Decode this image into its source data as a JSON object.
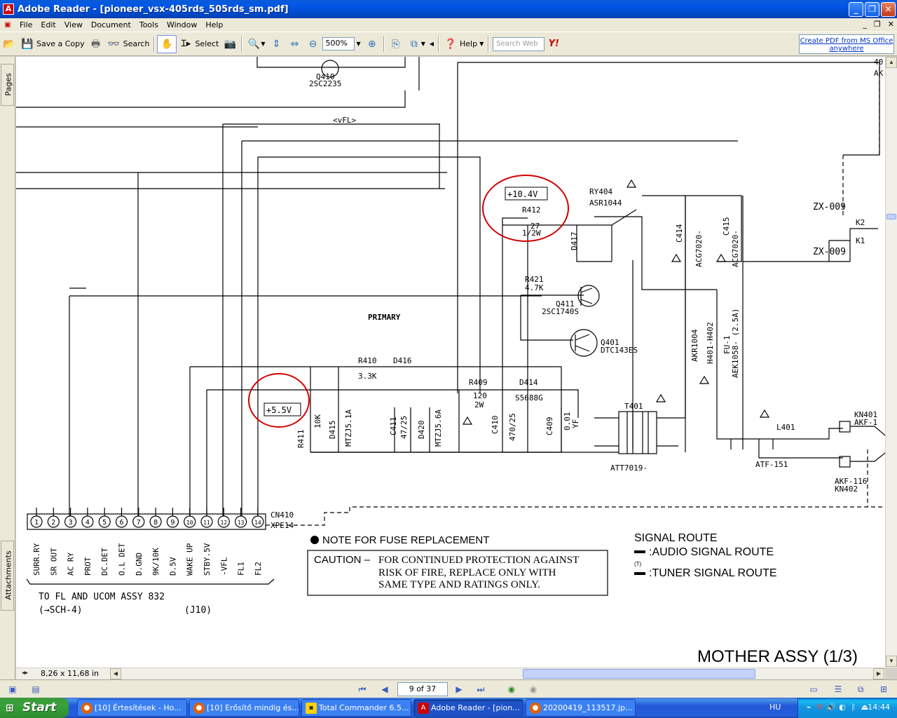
{
  "window": {
    "title": "Adobe Reader - [pioneer_vsx-405rds_505rds_sm.pdf]",
    "buttons": {
      "minimize": "_",
      "maximize": "❐",
      "close": "✕"
    }
  },
  "menu": {
    "items": [
      "File",
      "Edit",
      "View",
      "Document",
      "Tools",
      "Window",
      "Help"
    ],
    "mdi": {
      "minimize": "_",
      "restore": "❐",
      "close": "✕"
    }
  },
  "toolbar": {
    "save_copy": "Save a Copy",
    "search": "Search",
    "select": "Select",
    "zoom": "500%",
    "help": "Help",
    "search_web_placeholder": "Search Web",
    "create_pdf": "Create PDF from MS Office anywhere"
  },
  "nav_tabs": {
    "pages": "Pages",
    "attachments": "Attachments"
  },
  "document": {
    "page_size": "8,26 x 11,68 in",
    "schematic": {
      "title": "MOTHER ASSY (1/3)",
      "section": "PRIMARY",
      "vf_label": "<vFL>",
      "callout_1": "+10.4V",
      "callout_2": "+5.5V",
      "components": {
        "q410": "Q410",
        "q410_part": "2SC2235",
        "r412": "R412",
        "r412_val": "27",
        "r412_w": "1/2W",
        "ry404": "RY404",
        "ry404_part": "ASR1044",
        "d417": "D417",
        "c414": "C414",
        "c414_part": "ACG7020-",
        "c415": "C415",
        "c415_part": "ACG7020-",
        "zx1": "ZX-009",
        "zx2": "ZX-009",
        "k2": "K2",
        "k1": "K1",
        "r421": "R421",
        "r421_val": "4.7K",
        "q411": "Q411",
        "q411_part": "2SC1740S",
        "q401": "Q401",
        "q401_part": "DTC143ES",
        "akr": "AKR1004",
        "h401": "H401-H402",
        "fu1": "FU-1",
        "aek": "AEK1058- (2.5A)",
        "r410": "R410",
        "r410_val": "3.3K",
        "d416": "D416",
        "r409": "R409",
        "r409_val": "120",
        "r409_w": "2W",
        "d414": "D414",
        "d414_part": "S5688G",
        "t401": "T401",
        "att": "ATT7019-",
        "r411": "R411",
        "r411_val": "10K",
        "d415": "D415",
        "mtz1": "MTZJ5.1A",
        "c411": "C411",
        "c411_val": "47/25",
        "d420": "D420",
        "mtz2": "MTZJ5.6A",
        "c410": "C410",
        "c410_val": "470/25",
        "c409": "C409",
        "c409_val": "0.01",
        "c409_f": "YF",
        "l401": "L401",
        "atf": "ATF-151",
        "kn401": "KN401",
        "akf1": "AKF-1",
        "akf2": "AKF-116",
        "kn402": "KN402",
        "cn410": "CN410",
        "xpe": "XPE14",
        "top_right_1": "40",
        "top_right_2": "AK"
      },
      "connector_pins": [
        "1",
        "2",
        "3",
        "4",
        "5",
        "6",
        "7",
        "8",
        "9",
        "10",
        "11",
        "12",
        "13",
        "14"
      ],
      "pin_labels": [
        "SURR.RY",
        "SR OUT",
        "AC RY",
        "PROT",
        "DC.DET",
        "O.L DET",
        "D.GND",
        "9K/10K",
        "D.5V",
        "WAKE UP",
        "STBY.5V",
        "-VFL",
        "FL1",
        "FL2"
      ],
      "to_fl_1": "TO FL AND UCOM ASSY 832",
      "to_fl_2": "(→SCH-4)",
      "to_fl_3": "(J10)",
      "fuse_note": "NOTE FOR FUSE REPLACEMENT",
      "caution_label": "CAUTION –",
      "caution_1": "FOR CONTINUED PROTECTION AGAINST",
      "caution_2": "RISK OF FIRE, REPLACE ONLY WITH",
      "caution_3": "SAME TYPE AND RATINGS ONLY.",
      "signal_route": "SIGNAL ROUTE",
      "audio_route": ":AUDIO SIGNAL ROUTE",
      "tuner_route": ":TUNER SIGNAL ROUTE",
      "tuner_mark": "(T)"
    }
  },
  "statusbar": {
    "page": "9 of 37"
  },
  "taskbar": {
    "start": "Start",
    "tasks": [
      "[10] Értesítések - Ho...",
      "[10] Erősítő mindig és...",
      "Total Commander 6.5...",
      "Adobe Reader - [pion...",
      "20200419_113517.jp..."
    ],
    "lang": "HU",
    "clock": "14:44"
  },
  "colors": {
    "callout_circle": "#d10000",
    "xp_blue": "#0058e6",
    "start_green": "#37a23a"
  }
}
